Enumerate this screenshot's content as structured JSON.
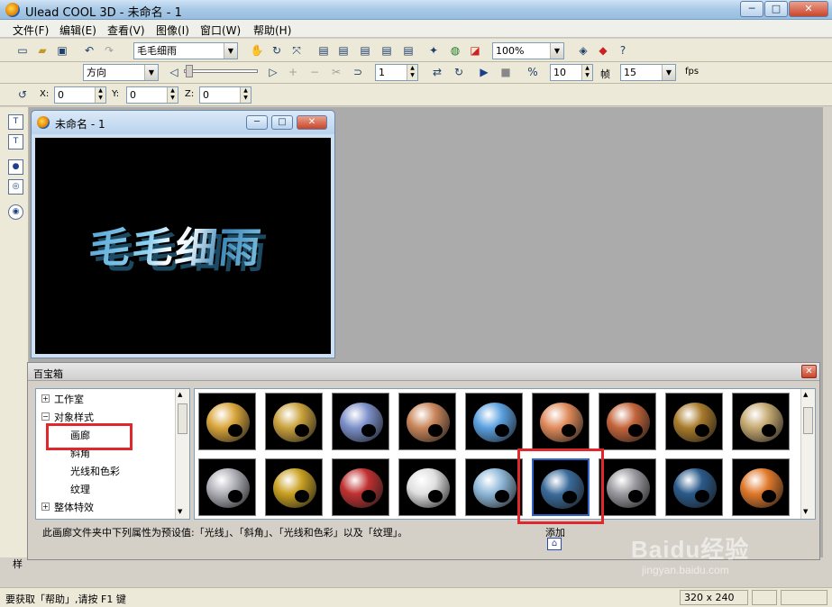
{
  "app": {
    "title": "Ulead COOL 3D - 未命名 - 1"
  },
  "window_buttons": {
    "minimize": "─",
    "maximize": "□",
    "close": "✕"
  },
  "menu": [
    "文件(F)",
    "编辑(E)",
    "查看(V)",
    "图像(I)",
    "窗口(W)",
    "帮助(H)"
  ],
  "toolbar1": {
    "text_object": "毛毛细雨",
    "zoom": "100%"
  },
  "toolbar2": {
    "direction": "方向",
    "frame": "1",
    "fps_value": "10",
    "frame_label": "帧",
    "total_frames": "15",
    "fps_label": "fps"
  },
  "toolbar3": {
    "x_label": "X:",
    "x_value": "0",
    "y_label": "Y:",
    "y_value": "0",
    "z_label": "Z:",
    "z_value": "0"
  },
  "document": {
    "title": "未命名 - 1",
    "canvas_text": "毛毛细雨"
  },
  "toolbox": {
    "title": "百宝箱",
    "tree": [
      {
        "label": "工作室",
        "expander": "+"
      },
      {
        "label": "对象样式",
        "expander": "−"
      },
      {
        "label": "画廊"
      },
      {
        "label": "斜角"
      },
      {
        "label": "光线和色彩"
      },
      {
        "label": "纹理"
      },
      {
        "label": "整体特效",
        "expander": "+"
      }
    ],
    "gallery_row1_colors": [
      "#d9a53a",
      "#c9a13b",
      "#7b8fc9",
      "#c9855a",
      "#5aa0e0",
      "#e08a5a",
      "#c3643a",
      "#a87a2a",
      "#c4a870"
    ],
    "gallery_row2_colors": [
      "#b0b0b8",
      "#c9a020",
      "#c03030",
      "#e0e0e0",
      "#8fb8d9",
      "#3a6a9a",
      "#9a9aa0",
      "#2a5a8a",
      "#e0782a"
    ],
    "selected_index": 5,
    "description": "此画廊文件夹中下列属性为预设值:「光线」、「斜角」、「光线和色彩」以及「纹理」。",
    "add_label": "添加"
  },
  "status": {
    "help_text": "要获取「帮助」,请按 F1 键",
    "dimensions": "320 x 240"
  },
  "watermark": {
    "brand": "Baidu经验",
    "url": "jingyan.baidu.com"
  },
  "behind_panel_label": "样"
}
